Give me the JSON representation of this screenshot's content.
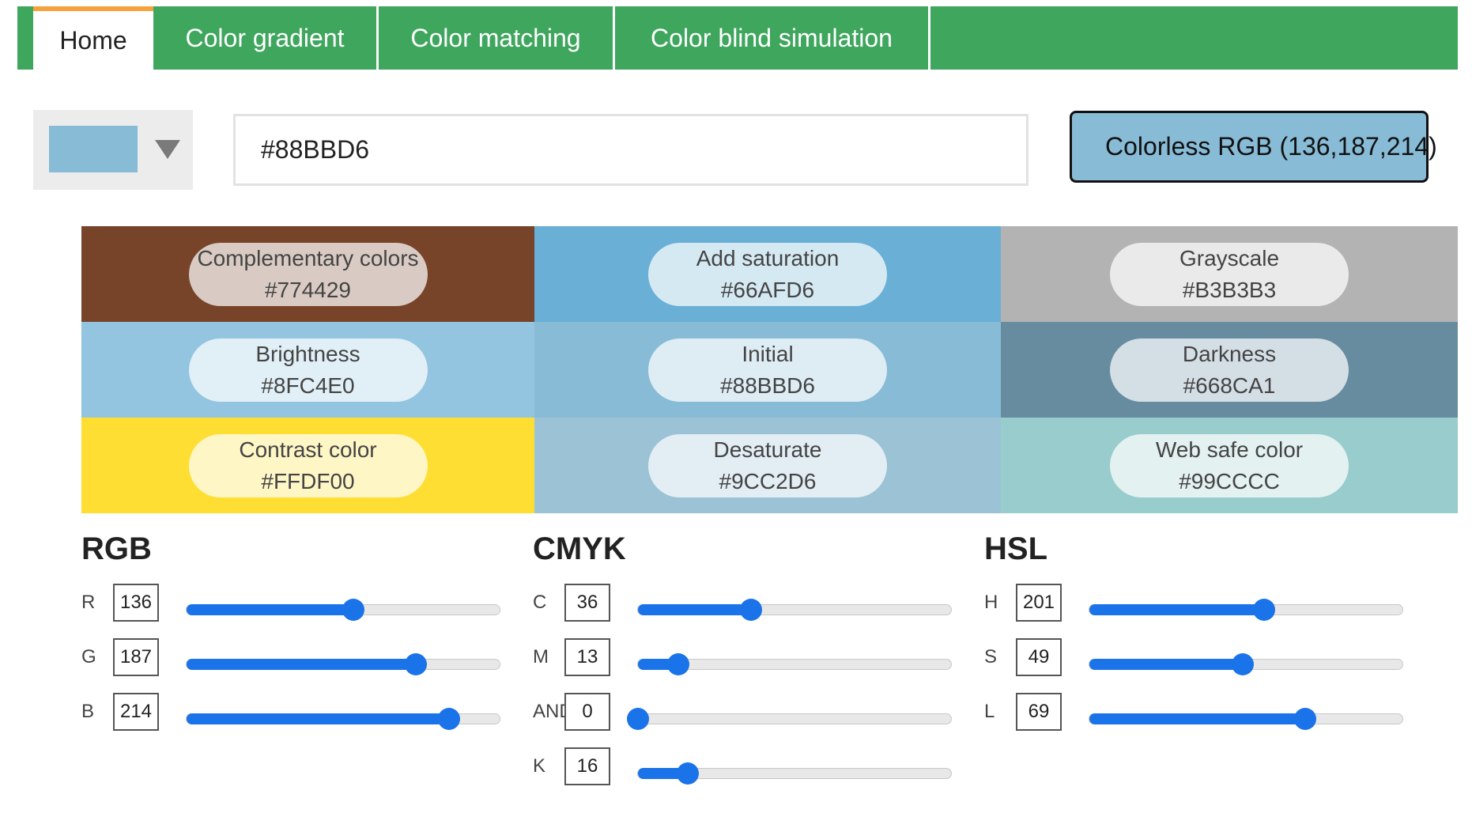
{
  "tabs": [
    {
      "label": "Home",
      "active": true
    },
    {
      "label": "Color gradient",
      "active": false
    },
    {
      "label": "Color matching",
      "active": false
    },
    {
      "label": "Color blind simulation",
      "active": false
    }
  ],
  "colors": {
    "tab_green": "#3fa65e",
    "tab_accent": "#f7a13a",
    "slider_blue": "#1a73e8",
    "current": "#88BBD6"
  },
  "picker": {
    "swatch_color": "#88BBD6",
    "dropdown_icon": "triangle-down-icon"
  },
  "hex_input": {
    "value": "#88BBD6"
  },
  "rgb_button": {
    "label": "Colorless RGB (136,187,214)",
    "color": "#88BBD6"
  },
  "swatches": [
    {
      "name": "Complementary colors",
      "hex": "#774429",
      "bg": "#774429",
      "pill_bg": "rgba(255,255,255,0.72)"
    },
    {
      "name": "Add saturation",
      "hex": "#66AFD6",
      "bg": "#6AAFD5"
    },
    {
      "name": "Grayscale",
      "hex": "#B3B3B3",
      "bg": "#B3B3B3"
    },
    {
      "name": "Brightness",
      "hex": "#8FC4E0",
      "bg": "#93C4E0"
    },
    {
      "name": "Initial",
      "hex": "#88BBD6",
      "bg": "#88BBD6"
    },
    {
      "name": "Darkness",
      "hex": "#668CA1",
      "bg": "#678CA0"
    },
    {
      "name": "Contrast color",
      "hex": "#FFDF00",
      "bg": "#FFDE33"
    },
    {
      "name": "Desaturate",
      "hex": "#9CC2D6",
      "bg": "#9CC2D6"
    },
    {
      "name": "Web safe color",
      "hex": "#99CCCC",
      "bg": "#99CCCC"
    }
  ],
  "rgb": {
    "title": "RGB",
    "rows": [
      {
        "label": "R",
        "value": "136",
        "fraction": 0.533
      },
      {
        "label": "G",
        "value": "187",
        "fraction": 0.733
      },
      {
        "label": "B",
        "value": "214",
        "fraction": 0.839
      }
    ]
  },
  "cmyk": {
    "title": "CMYK",
    "rows": [
      {
        "label": "C",
        "value": "36",
        "fraction": 0.36
      },
      {
        "label": "M",
        "value": "13",
        "fraction": 0.13
      },
      {
        "label": "AND",
        "value": "0",
        "fraction": 0.0
      },
      {
        "label": "K",
        "value": "16",
        "fraction": 0.16
      }
    ]
  },
  "hsl": {
    "title": "HSL",
    "rows": [
      {
        "label": "H",
        "value": "201",
        "fraction": 0.558
      },
      {
        "label": "S",
        "value": "49",
        "fraction": 0.49
      },
      {
        "label": "L",
        "value": "69",
        "fraction": 0.69
      }
    ]
  }
}
